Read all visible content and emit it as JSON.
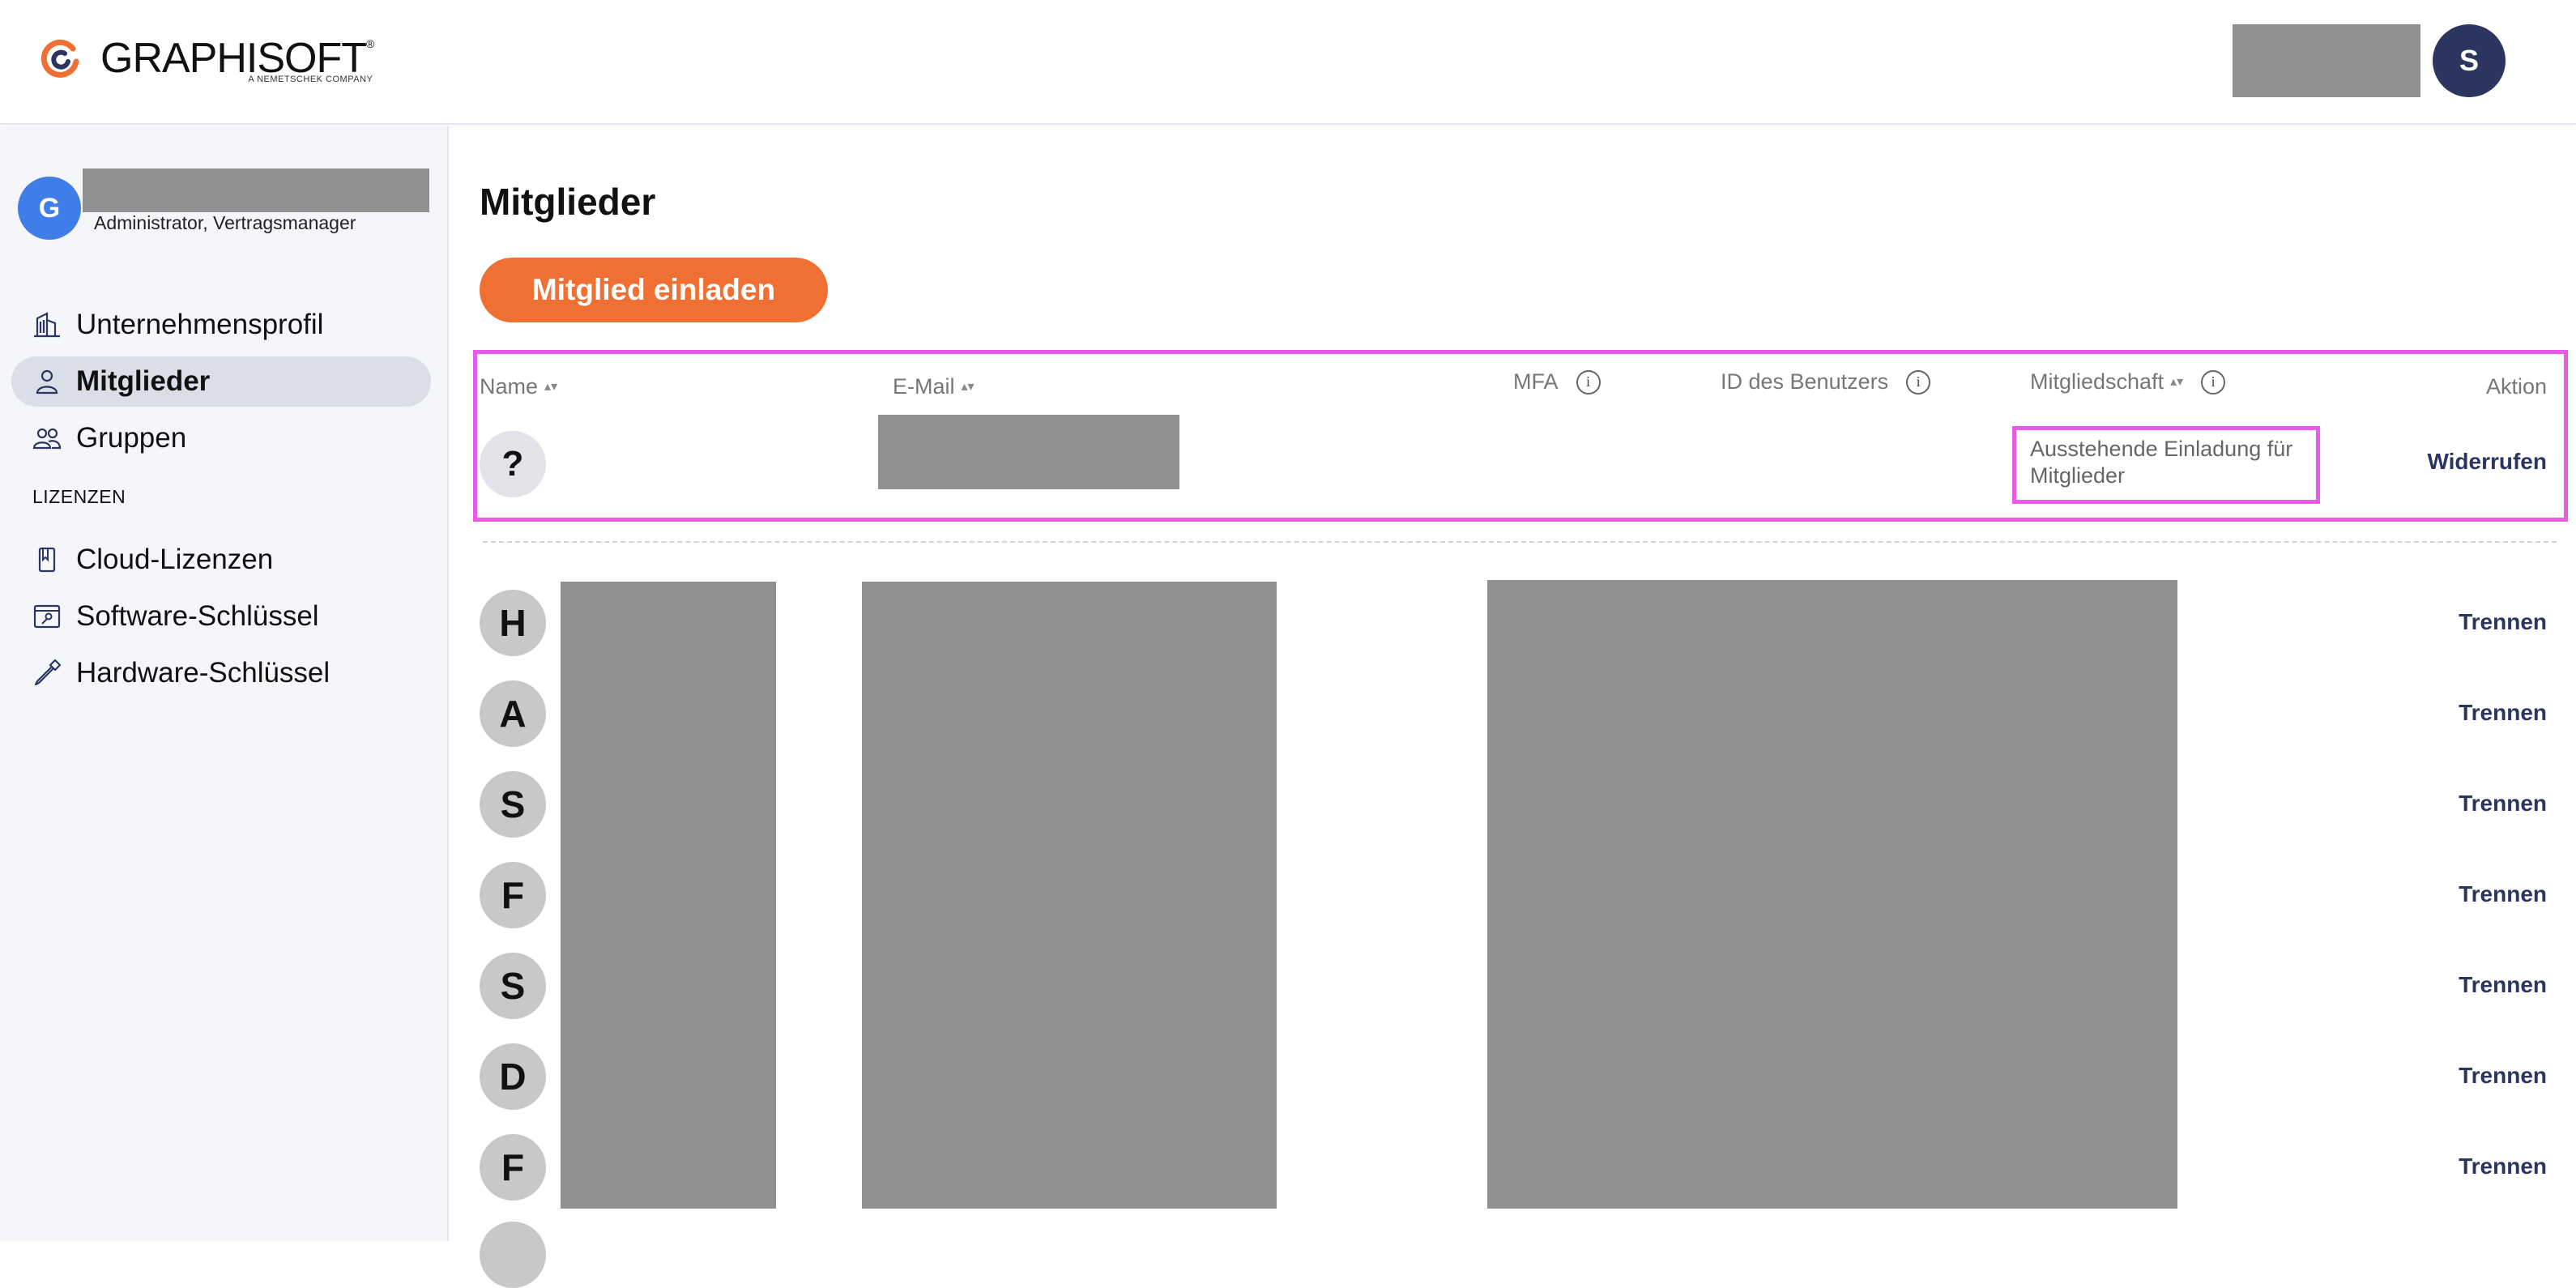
{
  "header": {
    "logo_text": "GRAPHISOFT",
    "logo_reg": "®",
    "logo_subtitle": "A NEMETSCHEK COMPANY",
    "user_initial": "S"
  },
  "sidebar": {
    "org_initial": "G",
    "org_role": "Administrator, Vertragsmanager",
    "items": [
      {
        "label": "Unternehmensprofil",
        "icon": "building-icon"
      },
      {
        "label": "Mitglieder",
        "icon": "person-icon"
      },
      {
        "label": "Gruppen",
        "icon": "group-icon"
      }
    ],
    "section_licenses": "LIZENZEN",
    "license_items": [
      {
        "label": "Cloud-Lizenzen",
        "icon": "cloud-license-icon"
      },
      {
        "label": "Software-Schlüssel",
        "icon": "software-key-icon"
      },
      {
        "label": "Hardware-Schlüssel",
        "icon": "hardware-key-icon"
      }
    ]
  },
  "main": {
    "title": "Mitglieder",
    "invite_button": "Mitglied einladen",
    "columns": {
      "name": "Name",
      "email": "E-Mail",
      "mfa": "MFA",
      "user_id": "ID des Benutzers",
      "membership": "Mitgliedschaft",
      "action": "Aktion"
    },
    "pending": {
      "initial": "?",
      "status": "Ausstehende Einladung für Mitglieder",
      "action": "Widerrufen"
    },
    "members": [
      {
        "initial": "H",
        "action": "Trennen"
      },
      {
        "initial": "A",
        "action": "Trennen"
      },
      {
        "initial": "S",
        "action": "Trennen"
      },
      {
        "initial": "F",
        "action": "Trennen"
      },
      {
        "initial": "S",
        "action": "Trennen"
      },
      {
        "initial": "D",
        "action": "Trennen"
      },
      {
        "initial": "F",
        "action": "Trennen"
      }
    ]
  },
  "colors": {
    "accent_orange": "#f07033",
    "navy": "#2b3560",
    "highlight_magenta": "#e85ae8",
    "org_blue": "#3f7ee8"
  }
}
